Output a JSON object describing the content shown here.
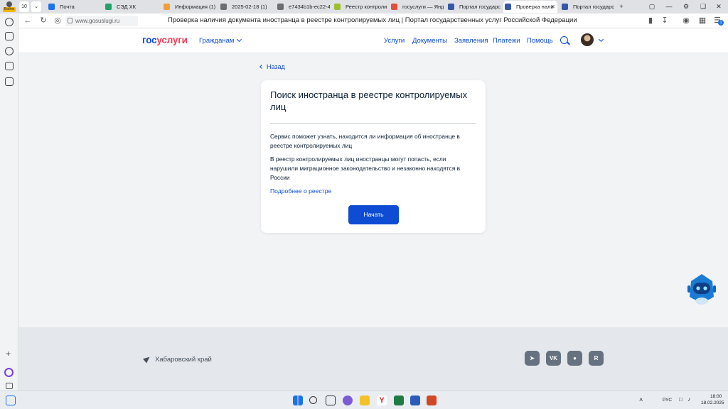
{
  "browser": {
    "tab_count": "10",
    "profile_label": "Войти",
    "tabs": [
      {
        "label": "Почта",
        "color": "#1a73e8"
      },
      {
        "label": "СЭД ХК",
        "color": "#1ea36b"
      },
      {
        "label": "Информация (1)",
        "color": "#f29d38"
      },
      {
        "label": "2025-02-18 (1)",
        "color": "#6d6d6d"
      },
      {
        "label": "e7434b1b-ec22-4",
        "color": "#6d6d6d"
      },
      {
        "label": "Реестр контроли",
        "color": "#9bbf2e"
      },
      {
        "label": "госуслуги — Янд",
        "color": "#e74c3c"
      },
      {
        "label": "Портал государс",
        "color": "#3557a8"
      },
      {
        "label": "Проверка нали",
        "color": "#3557a8"
      },
      {
        "label": "Портал государс",
        "color": "#3557a8"
      }
    ],
    "new_tab": "+",
    "url": "www.gosuslugi.ru",
    "page_title": "Проверка наличия документа иностранца в реестре контролируемых лиц | Портал государственных услуг Российской Федерации",
    "notification_badge": "1"
  },
  "header": {
    "logo_part1": "гос",
    "logo_part2": "услуги",
    "role": "Гражданам",
    "nav": [
      "Услуги",
      "Документы",
      "Заявления",
      "Платежи",
      "Помощь"
    ]
  },
  "main": {
    "back_label": "Назад",
    "title": "Поиск иностранца в реестре контролируемых лиц",
    "paragraph1": "Сервис поможет узнать, находится ли информация об иностранце в реестре контролируемых лиц",
    "paragraph2": "В реестр контролируемых лиц иностранцы могут попасть, если нарушили миграционное законодательство и незаконно находятся в России",
    "more_link": "Подробнее о реестре",
    "start_button": "Начать"
  },
  "footer": {
    "region": "Хабаровский край",
    "social": [
      "telegram-icon",
      "vk-icon",
      "odnoklassniki-icon",
      "rutube-icon"
    ]
  },
  "taskbar": {
    "lang": "РУС",
    "time": "18:00",
    "date": "18.02.2025"
  },
  "colors": {
    "accent": "#0d4cd3",
    "logo_red": "#ee3f58",
    "text": "#0b1f33",
    "footer_bg": "#e4e7eb"
  }
}
